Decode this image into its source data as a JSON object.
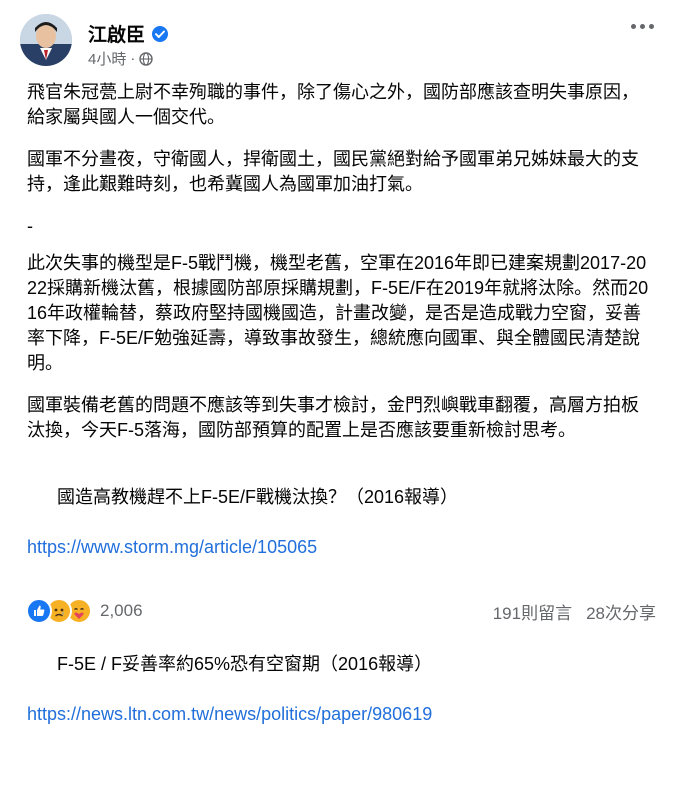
{
  "post": {
    "author_name": "江啟臣",
    "time": "4小時",
    "meta_separator": "·",
    "paragraphs": [
      "飛官朱冠甍上尉不幸殉職的事件，除了傷心之外，國防部應該查明失事原因，給家屬與國人一個交代。",
      "國軍不分晝夜，守衛國人，捍衛國土，國民黨絕對給予國軍弟兄姊妹最大的支持，逢此艱難時刻，也希冀國人為國軍加油打氣。",
      "-",
      "此次失事的機型是F-5戰鬥機，機型老舊，空軍在2016年即已建案規劃2017-2022採購新機汰舊，根據國防部原採購規劃，F-5E/F在2019年就將汰除。然而2016年政權輪替，蔡政府堅持國機國造，計畫改變，是否是造成戰力空窗，妥善率下降，F-5E/F勉強延壽，導致事故發生，總統應向國軍、與全體國民清楚說明。",
      "國軍裝備老舊的問題不應該等到失事才檢討，金門烈嶼戰車翻覆，高層方拍板汰換，今天F-5落海，國防部預算的配置上是否應該要重新檢討思考。"
    ],
    "link_blocks": [
      {
        "text": "國造高教機趕不上F-5E/F戰機汰換？（2016報導）",
        "url": "https://www.storm.mg/article/105065"
      },
      {
        "text": "F-5E / F妥善率約65%恐有空窗期（2016報導）",
        "url": "https://news.ltn.com.tw/news/politics/paper/980619"
      }
    ]
  },
  "footer": {
    "reaction_count": "2,006",
    "comments": "191則留言",
    "shares": "28次分享"
  },
  "colors": {
    "link": "#216fdb",
    "verified": "#1877f2",
    "meta": "#65676b",
    "like": "#1877f2",
    "sad": "#f7b125",
    "care": "#f7b125"
  },
  "icons": {
    "verified": "verified-badge-icon",
    "privacy": "globe-icon",
    "more": "more-options-icon",
    "reactions": [
      "like-reaction-icon",
      "sad-reaction-icon",
      "care-reaction-icon"
    ]
  }
}
